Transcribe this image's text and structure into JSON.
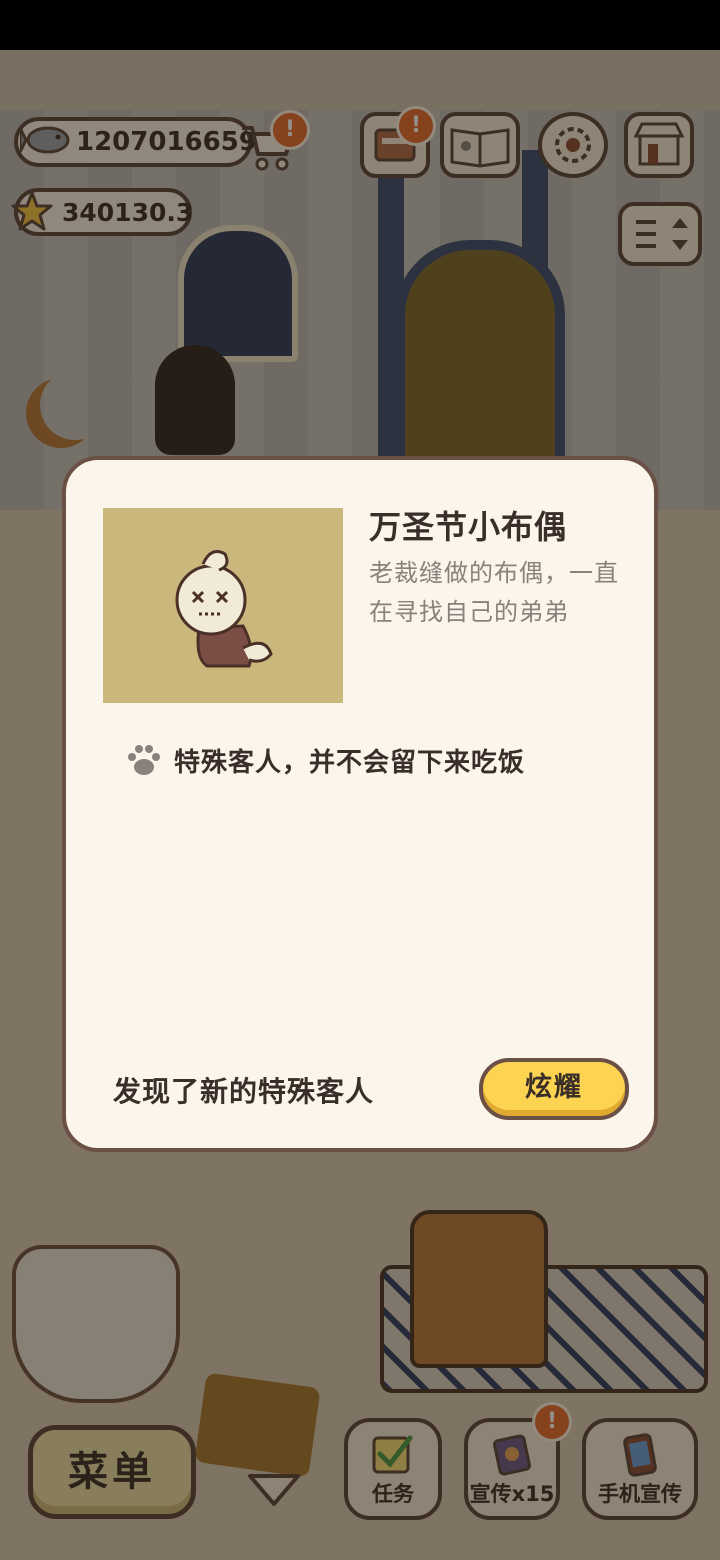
{
  "hud": {
    "fish_count": "1207016659",
    "star_count": "340130.3",
    "alert_mark": "!"
  },
  "dialog": {
    "title": "万圣节小布偶",
    "description": "老裁缝做的布偶，一直在寻找自己的弟弟",
    "trait": "特殊客人，并不会留下来吃饭",
    "found_text": "发现了新的特殊客人",
    "show_button": "炫耀"
  },
  "bottom_bar": {
    "menu_label": "菜单",
    "task_label": "任务",
    "promo_label": "宣传x15",
    "phone_promo_label": "手机宣传"
  },
  "icons": [
    "fish-icon",
    "star-icon",
    "cart-icon",
    "mail-icon",
    "cat-book-icon",
    "gear-icon",
    "shop-icon",
    "sort-icon",
    "paw-icon",
    "checkbox-icon",
    "flyer-icon",
    "phone-icon",
    "triangle-down-icon"
  ],
  "colors": {
    "accent_yellow": "#fdd451",
    "dialog_bg": "#fbf5ec",
    "border_brown": "#6a5045",
    "alert_orange": "#e76b2c"
  }
}
